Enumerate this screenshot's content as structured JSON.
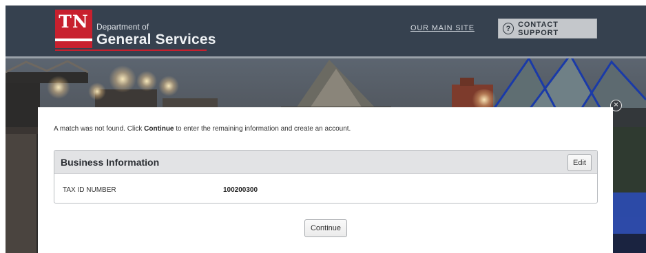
{
  "header": {
    "logo_mark": "TN",
    "logo_line1": "Department of",
    "logo_line2": "General Services",
    "main_site_link": "OUR MAIN SITE",
    "support_icon_glyph": "?",
    "support_label": "CONTACT SUPPORT"
  },
  "modal": {
    "close_glyph": "×",
    "message_before": "A match was not found. Click ",
    "message_bold": "Continue",
    "message_after": " to enter the remaining information and create an account.",
    "panel": {
      "title": "Business Information",
      "edit_label": "Edit",
      "field_label": "TAX ID NUMBER",
      "field_value": "100200300"
    },
    "continue_label": "Continue"
  },
  "colors": {
    "header_bg": "#36414f",
    "brand_red": "#c8202e"
  }
}
